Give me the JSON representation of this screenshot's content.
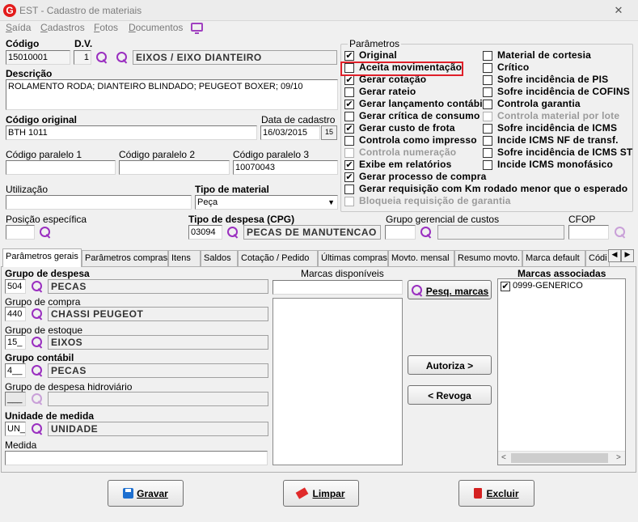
{
  "window": {
    "title": "EST - Cadastro de materiais",
    "close_label": "✕"
  },
  "menu": {
    "items": [
      "Saída",
      "Cadastros",
      "Fotos",
      "Documentos"
    ]
  },
  "form": {
    "codigo_label": "Código",
    "codigo_value": "15010001",
    "dv_label": "D.V.",
    "dv_value": "1",
    "eixo_value": "EIXOS / EIXO DIANTEIRO",
    "descricao_label": "Descrição",
    "descricao_value": "ROLAMENTO RODA; DIANTEIRO BLINDADO; PEUGEOT BOXER; 09/10",
    "codigo_original_label": "Código original",
    "codigo_original_value": "BTH 1011",
    "data_cadastro_label": "Data de cadastro",
    "data_cadastro_value": "16/03/2015",
    "date_btn": "15",
    "cod_paralelo1_label": "Código paralelo 1",
    "cod_paralelo1_value": "",
    "cod_paralelo2_label": "Código paralelo 2",
    "cod_paralelo2_value": "",
    "cod_paralelo3_label": "Código paralelo 3",
    "cod_paralelo3_value": "10070043",
    "utilizacao_label": "Utilização",
    "utilizacao_value": "",
    "tipo_material_label": "Tipo de material",
    "tipo_material_value": "Peça",
    "posicao_label": "Posição específica",
    "posicao_value": "",
    "tipo_despesa_label": "Tipo de despesa (CPG)",
    "tipo_despesa_code": "03094",
    "tipo_despesa_desc": "PECAS DE MANUTENCAO",
    "grupo_gerencial_label": "Grupo gerencial de custos",
    "grupo_gerencial_value": "",
    "cfop_label": "CFOP",
    "cfop_value": ""
  },
  "parametros": {
    "legend": "Parâmetros",
    "left": [
      {
        "label": "Original",
        "checked": true,
        "disabled": false
      },
      {
        "label": "Aceita movimentação",
        "checked": false,
        "disabled": false
      },
      {
        "label": "Gerar cotação",
        "checked": true,
        "disabled": false
      },
      {
        "label": "Gerar rateio",
        "checked": false,
        "disabled": false
      },
      {
        "label": "Gerar lançamento contábil",
        "checked": true,
        "disabled": false
      },
      {
        "label": "Gerar crítica de consumo",
        "checked": false,
        "disabled": false
      },
      {
        "label": "Gerar custo de frota",
        "checked": true,
        "disabled": false
      },
      {
        "label": "Controla como impresso",
        "checked": false,
        "disabled": false
      },
      {
        "label": "Controla numeração",
        "checked": false,
        "disabled": true
      },
      {
        "label": "Exibe em relatórios",
        "checked": true,
        "disabled": false
      },
      {
        "label": "Gerar processo de compra",
        "checked": true,
        "disabled": false
      },
      {
        "label": "Gerar requisição com Km rodado menor que o esperado",
        "checked": false,
        "disabled": false
      },
      {
        "label": "Bloqueia requisição de garantia",
        "checked": false,
        "disabled": true
      }
    ],
    "right": [
      {
        "label": "Material de cortesia",
        "checked": false,
        "disabled": false
      },
      {
        "label": "Crítico",
        "checked": false,
        "disabled": false
      },
      {
        "label": "Sofre incidência de PIS",
        "checked": false,
        "disabled": false
      },
      {
        "label": "Sofre incidência de COFINS",
        "checked": false,
        "disabled": false
      },
      {
        "label": "Controla garantia",
        "checked": false,
        "disabled": false
      },
      {
        "label": "Controla material por lote",
        "checked": false,
        "disabled": true
      },
      {
        "label": "Sofre incidência de ICMS",
        "checked": false,
        "disabled": false
      },
      {
        "label": "Incide ICMS NF de transf.",
        "checked": false,
        "disabled": false
      },
      {
        "label": "Sofre incidência de ICMS ST",
        "checked": false,
        "disabled": false
      },
      {
        "label": "Incide ICMS monofásico",
        "checked": false,
        "disabled": false
      }
    ]
  },
  "tabs": [
    "Parâmetros gerais",
    "Parâmetros compras",
    "Itens",
    "Saldos",
    "Cotação / Pedido",
    "Últimas compras",
    "Movto. mensal",
    "Resumo movto.",
    "Marca default",
    "Códi"
  ],
  "gerais": {
    "grupo_despesa_label": "Grupo de despesa",
    "grupo_despesa_code": "504",
    "grupo_despesa_desc": "PECAS",
    "grupo_compra_label": "Grupo de compra",
    "grupo_compra_code": "440",
    "grupo_compra_desc": "CHASSI PEUGEOT",
    "grupo_estoque_label": "Grupo de estoque",
    "grupo_estoque_code": "15_",
    "grupo_estoque_desc": "EIXOS",
    "grupo_contabil_label": "Grupo contábil",
    "grupo_contabil_code": "4__",
    "grupo_contabil_desc": "PECAS",
    "grupo_hidro_label": "Grupo de despesa hidroviário",
    "grupo_hidro_code": "___",
    "grupo_hidro_desc": "",
    "unidade_label": "Unidade de medida",
    "unidade_code": "UN_",
    "unidade_desc": "UNIDADE",
    "medida_label": "Medida",
    "medida_value": ""
  },
  "marcas": {
    "disponiveis_label": "Marcas disponíveis",
    "associadas_label": "Marcas associadas",
    "pesq_btn": "Pesq. marcas",
    "autoriza_btn": "Autoriza >",
    "revoga_btn": "< Revoga",
    "associadas": [
      {
        "label": "0999-GENERICO",
        "checked": true
      }
    ]
  },
  "buttons": {
    "gravar": "Gravar",
    "limpar": "Limpar",
    "excluir": "Excluir"
  },
  "colors": {
    "accent": "#9a2fc0",
    "highlight": "#e0202a"
  }
}
